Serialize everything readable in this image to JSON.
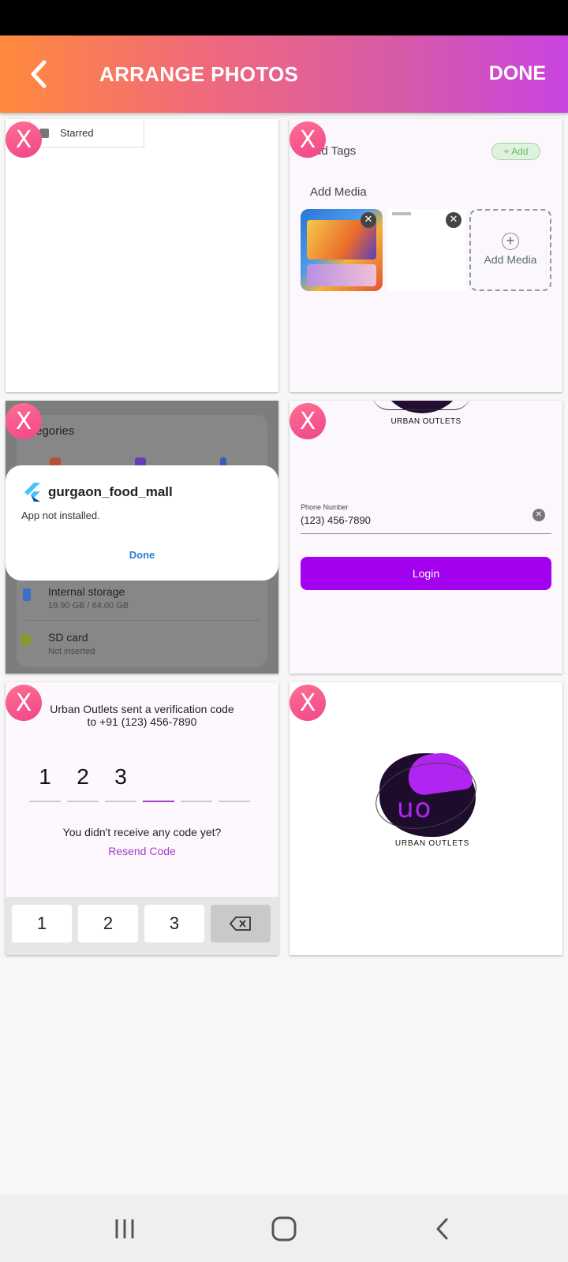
{
  "header": {
    "title": "ARRANGE PHOTOS",
    "done_label": "DONE",
    "back_icon": "chevron-left-icon"
  },
  "remove_label": "X",
  "tile1": {
    "chip_label": "Starred"
  },
  "tile2": {
    "tags_label": "dd Tags",
    "add_chip": "+ Add",
    "media_label": "Add Media",
    "add_media_button": "Add Media",
    "close_glyph": "✕"
  },
  "tile3": {
    "categories_label": "tegories",
    "dialog": {
      "app_name": "gurgaon_food_mall",
      "message": "App not installed.",
      "done": "Done"
    },
    "storage": [
      {
        "name": "Internal storage",
        "detail": "19.90 GB / 64.00 GB"
      },
      {
        "name": "SD card",
        "detail": "Not inserted"
      }
    ]
  },
  "tile4": {
    "brand": "URBAN OUTLETS",
    "phone_label": "Phone Number",
    "phone_value": "(123) 456-7890",
    "login_label": "Login",
    "accent": "#a400f0"
  },
  "tile5": {
    "message_line1": "Urban Outlets sent a verification code",
    "message_line2": "to +91 (123) 456-7890",
    "otp_digits": [
      "1",
      "2",
      "3",
      "",
      "",
      ""
    ],
    "no_code": "You didn't receive any code yet?",
    "resend": "Resend Code",
    "keys": [
      "1",
      "2",
      "3"
    ]
  },
  "tile6": {
    "logo_text": "uo",
    "brand": "URBAN OUTLETS"
  }
}
